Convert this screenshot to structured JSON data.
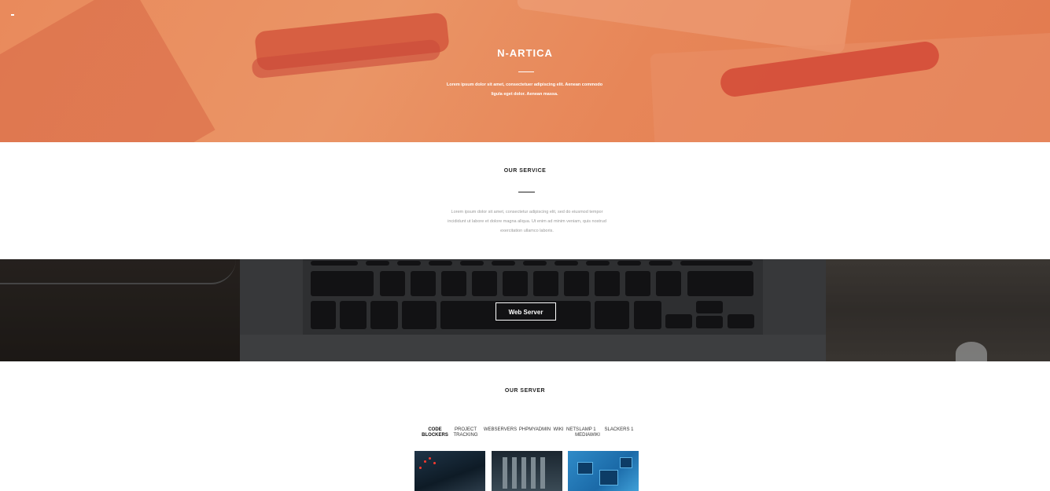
{
  "hero": {
    "brand": "N-ARTICA",
    "subtitle": "Lorem ipsum dolor sit amet, consectetuer adipiscing elit. Aenean commodo ligula eget dolor. Aenean massa."
  },
  "service": {
    "title": "OUR SERVICE",
    "text": "Lorem ipsum dolor sit amet, consectetur adipiscing elit, sed do eiusmod tempor incididunt ut labore et dolore magna aliqua. Ut enim ad minim veniam, quis nostrud exercitation ullamco laboris."
  },
  "banner": {
    "button_label": "Web Server"
  },
  "server": {
    "title": "OUR SERVER",
    "filters": [
      {
        "label": "CODE BLOCKERS"
      },
      {
        "label": "PROJECT TRACKING"
      },
      {
        "label": "WEBSERVERS"
      },
      {
        "label": "PHPMYADMIN"
      },
      {
        "label": "WIKI"
      },
      {
        "label": "NETS"
      },
      {
        "label": "LAMP 1 MEDIAWIKI"
      },
      {
        "label": "SLACKERS 1"
      }
    ]
  },
  "colors": {
    "hero_orange": "#e98a5c",
    "accent_red": "#d4563c",
    "text_dark": "#222222",
    "text_muted": "#9a9a9a"
  }
}
